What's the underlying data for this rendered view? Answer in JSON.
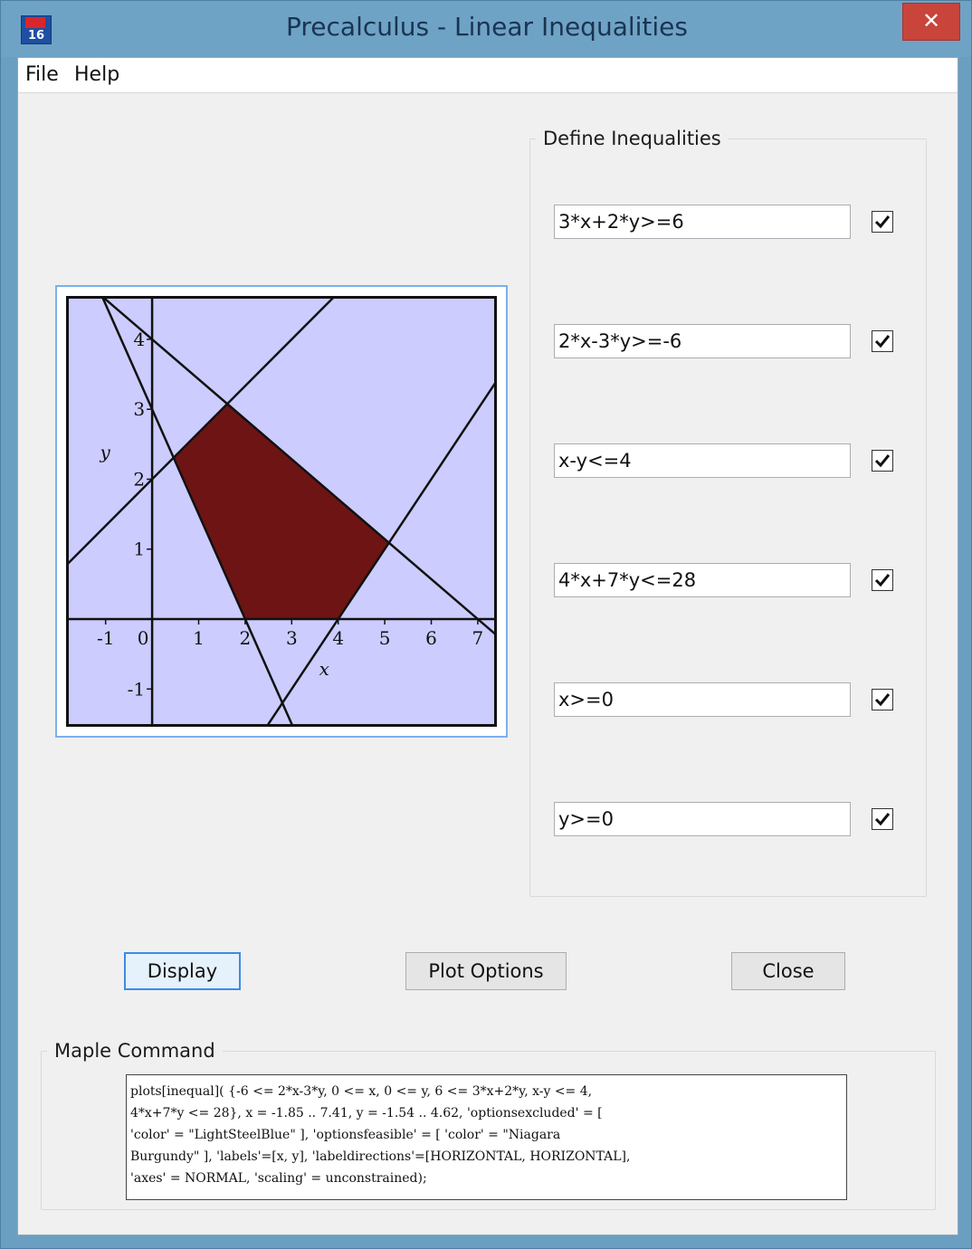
{
  "window": {
    "title": "Precalculus - Linear Inequalities",
    "icon_label": "16",
    "close_glyph": "✕"
  },
  "menu": {
    "items": [
      {
        "label": "File"
      },
      {
        "label": "Help"
      }
    ]
  },
  "inequalities": {
    "group_title": "Define Inequalities",
    "items": [
      {
        "value": "3*x+2*y>=6",
        "checked": true
      },
      {
        "value": "2*x-3*y>=-6",
        "checked": true
      },
      {
        "value": "x-y<=4",
        "checked": true
      },
      {
        "value": "4*x+7*y<=28",
        "checked": true
      },
      {
        "value": "x>=0",
        "checked": true
      },
      {
        "value": "y>=0",
        "checked": true
      }
    ]
  },
  "buttons": {
    "display": "Display",
    "plot_options": "Plot Options",
    "close": "Close"
  },
  "command": {
    "group_title": "Maple Command",
    "text": "plots[inequal]( {-6 <= 2*x-3*y, 0 <= x, 0 <= y, 6 <= 3*x+2*y, x-y <= 4,\n4*x+7*y <= 28}, x = -1.85 .. 7.41, y = -1.54 .. 4.62, 'optionsexcluded' = [\n'color' = \"LightSteelBlue\" ], 'optionsfeasible' = [ 'color' = \"Niagara\nBurgundy\" ], 'labels'=[x, y], 'labeldirections'=[HORIZONTAL, HORIZONTAL],\n'axes' = NORMAL, 'scaling' = unconstrained);"
  },
  "chart_data": {
    "type": "area",
    "xlabel": "x",
    "ylabel": "y",
    "xlim": [
      -1.85,
      7.41
    ],
    "ylim": [
      -1.54,
      4.62
    ],
    "x_ticks": [
      -1,
      0,
      1,
      2,
      3,
      4,
      5,
      6,
      7
    ],
    "y_ticks": [
      -1,
      1,
      2,
      3,
      4
    ],
    "excluded_color": "#ccccff",
    "feasible_color": "#6e1414",
    "lines": [
      {
        "a": 3,
        "b": 2,
        "c": 6
      },
      {
        "a": 2,
        "b": -3,
        "c": -6
      },
      {
        "a": 1,
        "b": -1,
        "c": 4
      },
      {
        "a": 4,
        "b": 7,
        "c": 28
      }
    ],
    "feasible_region": [
      [
        2,
        0
      ],
      [
        0.46,
        2.31
      ],
      [
        1.62,
        3.08
      ],
      [
        5.09,
        1.09
      ],
      [
        4,
        0
      ]
    ]
  }
}
